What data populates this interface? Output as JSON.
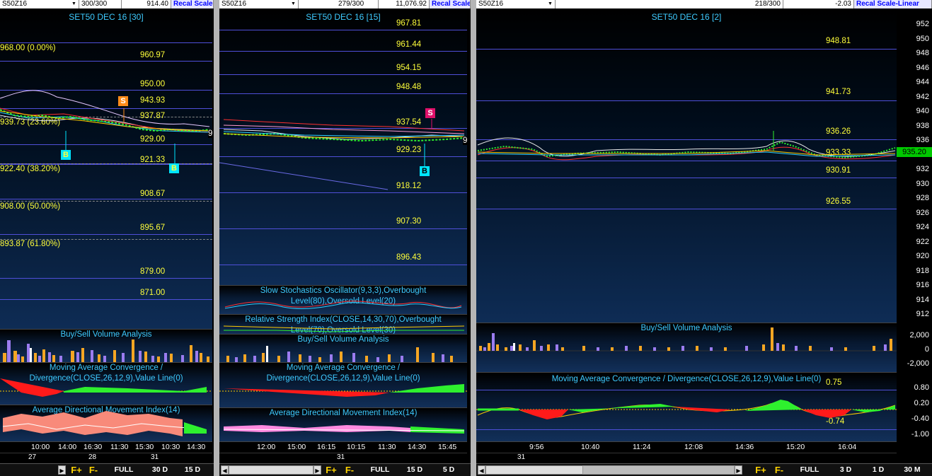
{
  "panes": [
    {
      "header": {
        "symbol": "S50Z16",
        "bars": "300/300",
        "value": "914.40",
        "recal": "Recal Scale"
      },
      "title": "SET50 DEC 16  [30]",
      "levels": [
        "960.97",
        "950.00",
        "943.93",
        "937.87",
        "929.00",
        "921.33",
        "908.67",
        "895.67",
        "879.00",
        "871.00"
      ],
      "fibo": [
        "968.00 (0.00%)",
        "939.73 (23.60%)",
        "922.40 (38.20%)",
        "908.00 (50.00%)",
        "893.87 (61.80%)"
      ],
      "right_partial": "9",
      "signals": {
        "sell": "S",
        "buy1": "B",
        "buy2": "B"
      },
      "sub_titles": {
        "volume": "Buy/Sell Volume Analysis",
        "macd": "Moving Average Convergence / Divergence(CLOSE,26,12,9),Value Line(0)",
        "adx": "Average Directional Movement Index(14)"
      },
      "times": [
        "10:00",
        "14:00",
        "16:30",
        "11:30",
        "15:30",
        "10:30",
        "14:30"
      ],
      "dates": [
        "27",
        "28",
        "31"
      ],
      "toolbar": {
        "f_plus": "F+",
        "f_minus": "F-",
        "full": "FULL",
        "b1": "30 D",
        "b2": "15 D"
      }
    },
    {
      "header": {
        "symbol": "S50Z16",
        "bars": "279/300",
        "value": "11,076.92",
        "recal": "Recal Scale"
      },
      "title": "SET50 DEC 16  [15]",
      "levels": [
        "967.81",
        "961.44",
        "954.15",
        "948.48",
        "937.54",
        "929.23",
        "918.12",
        "907.30",
        "896.43"
      ],
      "right_partial": "9",
      "signals": {
        "sell": "S",
        "buy": "B"
      },
      "sub_titles": {
        "stoch": "Slow Stochastics Oscillator(9,3,3),Overbought Level(80),Oversold Level(20)",
        "rsi": "Relative Strength Index(CLOSE,14,30,70),Overbought Level(70),Oversold Level(30)",
        "volume": "Buy/Sell Volume Analysis",
        "macd": "Moving Average Convergence / Divergence(CLOSE,26,12,9),Value Line(0)",
        "adx": "Average Directional Movement Index(14)"
      },
      "times": [
        "12:00",
        "15:00",
        "16:15",
        "10:15",
        "11:30",
        "14:30",
        "15:45"
      ],
      "dates": [
        "31"
      ],
      "toolbar": {
        "f_plus": "F+",
        "f_minus": "F-",
        "full": "FULL",
        "b1": "15 D",
        "b2": "5 D"
      }
    },
    {
      "header": {
        "symbol": "S50Z16",
        "bars": "218/300",
        "value": "-2.03",
        "recal": "Recal Scale-Linear"
      },
      "title": "SET50 DEC 16  [2]",
      "levels": [
        "948.81",
        "941.73",
        "936.26",
        "933.33",
        "930.91",
        "926.55"
      ],
      "price_scale": [
        "952",
        "950",
        "948",
        "946",
        "944",
        "942",
        "940",
        "938",
        "936",
        "934",
        "932",
        "930",
        "928",
        "926",
        "924",
        "922",
        "920",
        "918",
        "916",
        "914",
        "912"
      ],
      "current_price": "935.20",
      "volume_scale": [
        "2,000",
        "0",
        "-2,000"
      ],
      "macd_scale": [
        "0.80",
        "0.20",
        "-0.40",
        "-1.00"
      ],
      "macd_values": {
        "top": "0.75",
        "bottom": "-0.74"
      },
      "sub_titles": {
        "volume": "Buy/Sell Volume Analysis",
        "macd": "Moving Average Convergence / Divergence(CLOSE,26,12,9),Value Line(0)"
      },
      "times": [
        "9:56",
        "10:40",
        "11:24",
        "12:08",
        "14:36",
        "15:20",
        "16:04"
      ],
      "dates": [
        "31"
      ],
      "toolbar": {
        "f_plus": "F+",
        "f_minus": "F-",
        "full": "FULL",
        "b1": "3 D",
        "b2": "1 D",
        "b3": "30 M"
      }
    }
  ],
  "colors": {
    "level_line": "#4f4fd8",
    "level_text": "#ffff3a",
    "title": "#3ecbff",
    "buy_bar": "#f5a623",
    "sell_bar": "#9b7cf0",
    "sell_signal": "#e0106a",
    "buy_signal": "#00e5ff",
    "orange_signal": "#ff8c1a"
  }
}
